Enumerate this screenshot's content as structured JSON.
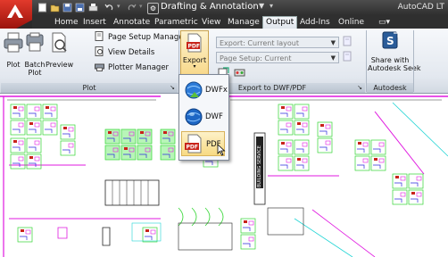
{
  "titlebar": {
    "workspace": "Drafting & Annotation",
    "app_title": "AutoCAD LT"
  },
  "tabs": [
    "Home",
    "Insert",
    "Annotate",
    "Parametric",
    "View",
    "Manage",
    "Output",
    "Add-Ins",
    "Online"
  ],
  "active_tab": "Output",
  "plot_panel": {
    "title": "Plot",
    "plot_label": "Plot",
    "batch_plot_label": "Batch\nPlot",
    "preview_label": "Preview",
    "page_setup_manager": "Page Setup Manager",
    "view_details": "View Details",
    "plotter_manager": "Plotter Manager"
  },
  "export_panel": {
    "export_label": "Export",
    "export_combo": "Export: Current layout",
    "page_setup_combo": "Page Setup: Current",
    "title": "Export to DWF/PDF"
  },
  "seek_panel": {
    "share_label": "Share with\nAutodesk Seek",
    "title": "Autodesk Seek"
  },
  "export_menu": {
    "items": [
      {
        "label": "DWFx",
        "icon": "dwfx-globe-icon"
      },
      {
        "label": "DWF",
        "icon": "dwf-globe-icon"
      },
      {
        "label": "PDF",
        "icon": "pdf-icon"
      }
    ],
    "hovered": "PDF"
  },
  "drawing": {
    "vertical_label": "BUILDING SERVICE"
  },
  "colors": {
    "accent_red": "#c8231a",
    "cad_green": "#33d633",
    "cad_magenta": "#e019e0",
    "cad_cyan": "#1fd4d4",
    "cad_blue": "#2b2bdb",
    "hover": "#f7da83"
  }
}
